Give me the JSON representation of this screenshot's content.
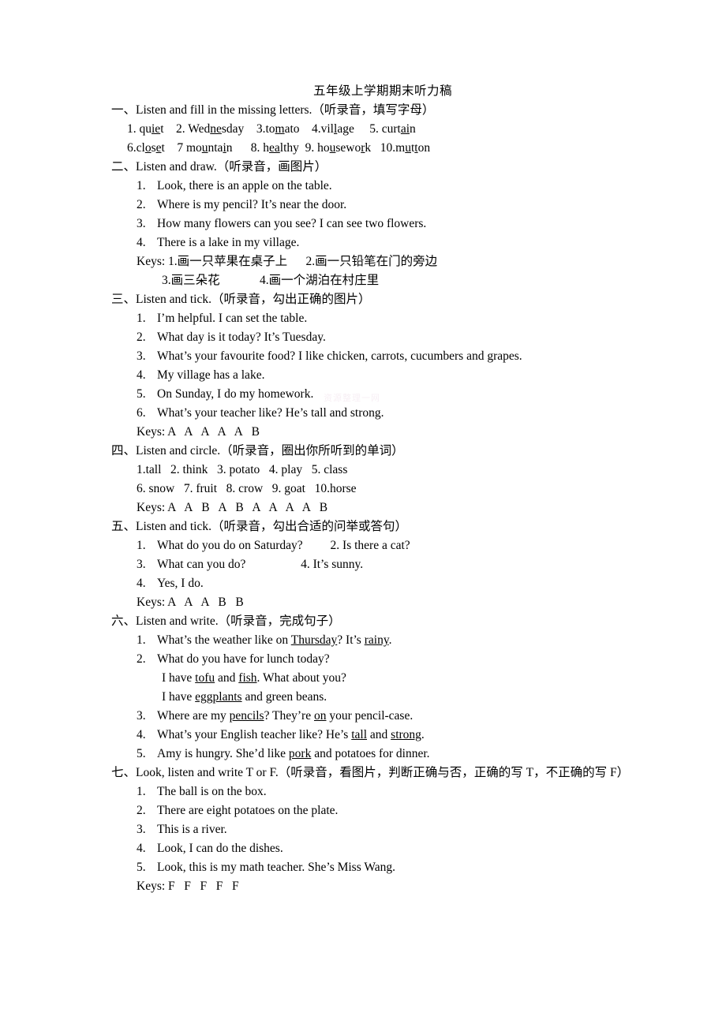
{
  "document": {
    "title": "五年级上学期期末听力稿",
    "watermark": "资源整理一网"
  },
  "sections": [
    {
      "marker": "一、",
      "heading": "一、Listen and fill in the missing letters.（听录音，填写字母）",
      "lines": [
        "1. qu_ie_t    2. Wed_ne_sday    3.to_m_ato    4.vil_l_age     5. curt_ai_n",
        "6.cl_o_s_e_t    7 mo_u_nta_i_n      8. h_ea_lthy   9. ho_u_sewo_r_k   10.m_u_t_t_on"
      ],
      "words_row1": [
        {
          "num": "1.",
          "pre": "qu",
          "u": "ie",
          "post": "t"
        },
        {
          "num": "2.",
          "pre": "Wed",
          "u": "ne",
          "post": "sday"
        },
        {
          "num": "3.",
          "pre": "to",
          "u": "m",
          "post": "ato"
        },
        {
          "num": "4.",
          "pre": "vil",
          "u": "l",
          "post": "age"
        },
        {
          "num": "5.",
          "pre": "curt",
          "u": "ai",
          "post": "n"
        }
      ],
      "words_row2": [
        {
          "num": "6.",
          "text": "closet",
          "underlined": "o,e"
        },
        {
          "num": "7",
          "text": "mountain",
          "underlined": "u,i"
        },
        {
          "num": "8.",
          "text": "healthy",
          "underlined": "ea"
        },
        {
          "num": "9.",
          "text": "housework",
          "underlined": "u,r"
        },
        {
          "num": "10.",
          "text": "mutton",
          "underlined": "u,tt"
        }
      ]
    },
    {
      "marker": "二、",
      "heading": "二、Listen and draw.（听录音，画图片）",
      "items": [
        {
          "num": "1.",
          "text": "Look, there is an apple on the table."
        },
        {
          "num": "2.",
          "text": "Where is my pencil? It’s near the door."
        },
        {
          "num": "3.",
          "text": "How many flowers can you see? I can see two flowers."
        },
        {
          "num": "4.",
          "text": "There is a lake in my village."
        }
      ],
      "keys_lines": [
        "Keys: 1.画一只苹果在桌子上      2.画一只铅笔在门的旁边",
        "3.画三朵花                 4.画一个湖泊在村庄里"
      ],
      "keys_label": "Keys:",
      "keys_a1": "1.画一只苹果在桌子上",
      "keys_a2": "2.画一只铅笔在门的旁边",
      "keys_b1": "3.画三朵花",
      "keys_b2": "4.画一个湖泊在村庄里"
    },
    {
      "marker": "三、",
      "heading": "三、Listen and tick.（听录音，勾出正确的图片）",
      "items": [
        {
          "num": "1.",
          "text": "I’m helpful. I can set the table."
        },
        {
          "num": "2.",
          "text": "What day is it today? It’s Tuesday."
        },
        {
          "num": "3.",
          "text": "What’s your favourite food? I like chicken, carrots, cucumbers and grapes."
        },
        {
          "num": "4.",
          "text": "My village has a lake."
        },
        {
          "num": "5.",
          "text": "On Sunday, I do my homework."
        },
        {
          "num": "6.",
          "text": "What’s your teacher like? He’s tall and strong."
        }
      ],
      "keys": "Keys: A   A   A   A   A   B"
    },
    {
      "marker": "四、",
      "heading": "四、Listen and circle.（听录音，圈出你所听到的单词）",
      "lines": [
        "1.tall   2. think   3. potato   4. play   5. class",
        "6. snow   7. fruit   8. crow   9. goat   10.horse"
      ],
      "keys": "Keys: A   A   B   A   B   A   A   A   A   B"
    },
    {
      "marker": "五、",
      "heading": "五、Listen and tick.（听录音，勾出合适的问举或答句）",
      "items": [
        {
          "num": "1.",
          "text": "What do you do on Saturday?",
          "right": "2. Is there a cat?"
        },
        {
          "num": "3.",
          "text": "What can you do?",
          "right": "4. It’s sunny."
        },
        {
          "num": "4.",
          "text": "Yes, I do.",
          "right": ""
        }
      ],
      "keys": "Keys: A   A   A   B   B"
    },
    {
      "marker": "六、",
      "heading": "六、Listen and write.（听录音，完成句子）",
      "items": [
        {
          "num": "1.",
          "segments": [
            {
              "t": "What’s the weather like on ",
              "u": false
            },
            {
              "t": "Thursday",
              "u": true
            },
            {
              "t": "? It’s ",
              "u": false
            },
            {
              "t": "rainy",
              "u": true
            },
            {
              "t": ".",
              "u": false
            }
          ]
        },
        {
          "num": "2.",
          "segments": [
            {
              "t": "What do you have for lunch today?",
              "u": false
            }
          ]
        },
        {
          "num": "",
          "indent": true,
          "segments": [
            {
              "t": "I have ",
              "u": false
            },
            {
              "t": "tofu",
              "u": true
            },
            {
              "t": " and ",
              "u": false
            },
            {
              "t": "fish",
              "u": true
            },
            {
              "t": ". What about you?",
              "u": false
            }
          ]
        },
        {
          "num": "",
          "indent": true,
          "segments": [
            {
              "t": "I have ",
              "u": false
            },
            {
              "t": "eggplants",
              "u": true
            },
            {
              "t": " and green beans.",
              "u": false
            }
          ]
        },
        {
          "num": "3.",
          "segments": [
            {
              "t": "Where are my ",
              "u": false
            },
            {
              "t": "pencils",
              "u": true
            },
            {
              "t": "? They’re ",
              "u": false
            },
            {
              "t": "on",
              "u": true
            },
            {
              "t": " your pencil-case.",
              "u": false
            }
          ]
        },
        {
          "num": "4.",
          "segments": [
            {
              "t": "What’s your English teacher like? He’s ",
              "u": false
            },
            {
              "t": "tall",
              "u": true
            },
            {
              "t": " and ",
              "u": false
            },
            {
              "t": "strong",
              "u": true
            },
            {
              "t": ".",
              "u": false
            }
          ]
        },
        {
          "num": "5.",
          "segments": [
            {
              "t": "Amy is hungry. She’d like ",
              "u": false
            },
            {
              "t": "pork",
              "u": true
            },
            {
              "t": " and potatoes for dinner.",
              "u": false
            }
          ]
        }
      ]
    },
    {
      "marker": "七、",
      "heading": "七、Look, listen and write T or F.（听录音，看图片，判断正确与否，正确的写 T，不正确的写 F）",
      "items": [
        {
          "num": "1.",
          "text": "The ball is on the box."
        },
        {
          "num": "2.",
          "text": "There are eight potatoes on the plate."
        },
        {
          "num": "3.",
          "text": "This is a river."
        },
        {
          "num": "4.",
          "text": "Look, I can do the dishes."
        },
        {
          "num": "5.",
          "text": "Look, this is my math teacher. She’s Miss Wang."
        }
      ],
      "keys": "Keys: F   F   F   F   F"
    }
  ]
}
